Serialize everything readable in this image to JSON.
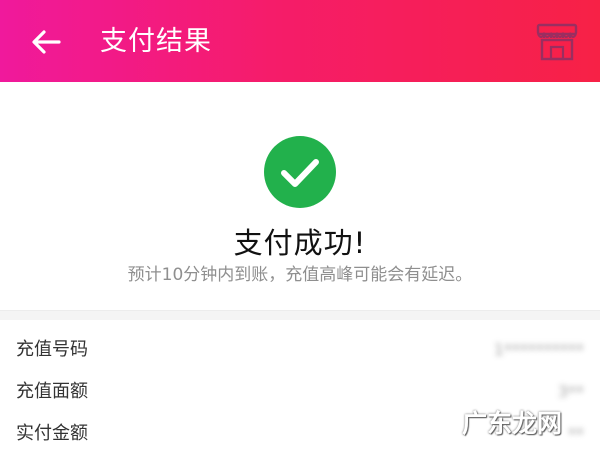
{
  "header": {
    "title": "支付结果",
    "back_icon": "arrow-left-icon",
    "store_icon": "store-icon",
    "gradient_start": "#f0199c",
    "gradient_end": "#f72146"
  },
  "result": {
    "status_icon": "checkmark-circle-icon",
    "status_color": "#22b14c",
    "title": "支付成功!",
    "note": "预计10分钟内到账，充值高峰可能会有延迟。"
  },
  "details": [
    {
      "label": "充值号码",
      "value": "1**********"
    },
    {
      "label": "充值面额",
      "value": "3**"
    },
    {
      "label": "实付金额",
      "value": "**"
    }
  ],
  "watermark": "广东龙网"
}
